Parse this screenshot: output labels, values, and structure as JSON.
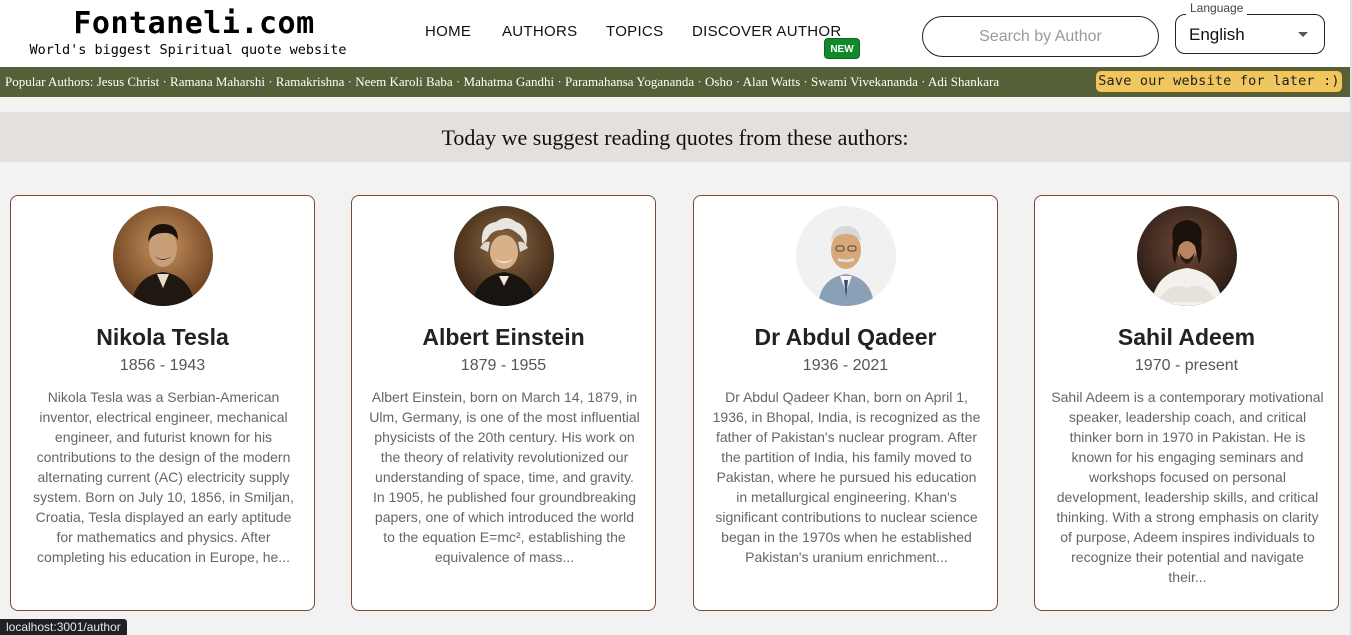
{
  "header": {
    "logo_title": "Fontaneli.com",
    "logo_subtitle": "World's biggest Spiritual quote website",
    "nav": [
      {
        "label": "HOME"
      },
      {
        "label": "AUTHORS"
      },
      {
        "label": "TOPICS"
      },
      {
        "label": "DISCOVER AUTHOR"
      }
    ],
    "new_badge": "NEW",
    "search_placeholder": "Search by Author",
    "language_label": "Language",
    "language_value": "English"
  },
  "popular": {
    "text": "Popular Authors: Jesus Christ · Ramana Maharshi · Ramakrishna · Neem Karoli Baba · Mahatma Gandhi · Paramahansa Yogananda · Osho · Alan Watts · Swami Vivekananda · Adi Shankara",
    "save_button": "Save our website for later :)"
  },
  "suggest_heading": "Today we suggest reading quotes from these authors:",
  "cards": [
    {
      "name": "Nikola Tesla",
      "years": "1856 - 1943",
      "description": "Nikola Tesla was a Serbian-American inventor, electrical engineer, mechanical engineer, and futurist known for his contributions to the design of the modern alternating current (AC) electricity supply system. Born on July 10, 1856, in Smiljan, Croatia, Tesla displayed an early aptitude for mathematics and physics. After completing his education in Europe, he..."
    },
    {
      "name": "Albert Einstein",
      "years": "1879 - 1955",
      "description": "Albert Einstein, born on March 14, 1879, in Ulm, Germany, is one of the most influential physicists of the 20th century. His work on the theory of relativity revolutionized our understanding of space, time, and gravity. In 1905, he published four groundbreaking papers, one of which introduced the world to the equation E=mc², establishing the equivalence of mass..."
    },
    {
      "name": "Dr Abdul Qadeer",
      "years": "1936 - 2021",
      "description": "Dr Abdul Qadeer Khan, born on April 1, 1936, in Bhopal, India, is recognized as the father of Pakistan's nuclear program. After the partition of India, his family moved to Pakistan, where he pursued his education in metallurgical engineering. Khan's significant contributions to nuclear science began in the 1970s when he established Pakistan's uranium enrichment..."
    },
    {
      "name": "Sahil Adeem",
      "years": "1970 - present",
      "description": "Sahil Adeem is a contemporary motivational speaker, leadership coach, and critical thinker born in 1970 in Pakistan. He is known for his engaging seminars and workshops focused on personal development, leadership skills, and critical thinking. With a strong emphasis on clarity of purpose, Adeem inspires individuals to recognize their potential and navigate their..."
    }
  ],
  "status_url": "localhost:3001/author",
  "colors": {
    "popular_bar": "#556039",
    "save_button": "#f0c75e",
    "new_badge": "#12892a",
    "card_border": "#7a4a36",
    "suggest_band": "#e3e0dd"
  }
}
